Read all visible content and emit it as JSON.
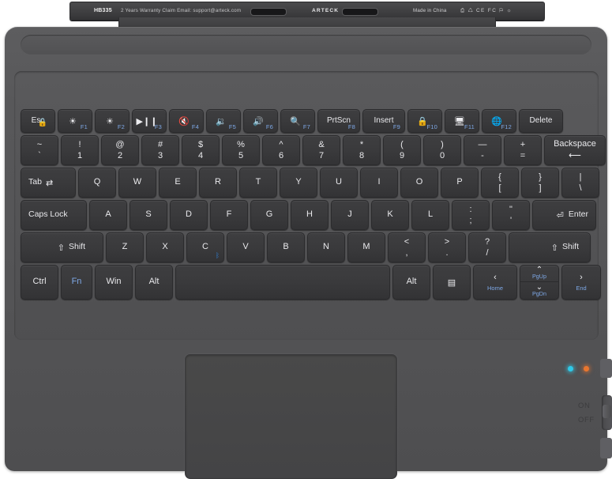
{
  "product": {
    "brand": "ARTECK",
    "model": "HB335",
    "warranty_text": "2 Years Warranty Claim Email: support@arteck.com",
    "origin": "Made in China",
    "certifications": "⎙ ♺ CE FC ⚐ ☼",
    "colors": {
      "body": "#55555 7",
      "key": "#3a3a3c",
      "accent_blue": "#7ea8e6",
      "led_blue": "#2fc9e8",
      "led_orange": "#e8762f"
    }
  },
  "power_switch": {
    "on_label": "ON",
    "off_label": "OFF"
  },
  "indicators": [
    {
      "name": "bluetooth-led",
      "color": "#2fc9e8"
    },
    {
      "name": "battery-led",
      "color": "#e8762f"
    }
  ],
  "keyboard": {
    "function_row": [
      {
        "label": "Esc",
        "fn": "",
        "glyph": "",
        "badge": "lock"
      },
      {
        "label": "",
        "fn": "F1",
        "glyph": "☀",
        "badge": ""
      },
      {
        "label": "",
        "fn": "F2",
        "glyph": "☀",
        "badge": ""
      },
      {
        "label": "",
        "fn": "F3",
        "glyph": "▶❙❙",
        "badge": ""
      },
      {
        "label": "",
        "fn": "F4",
        "glyph": "🔇",
        "badge": ""
      },
      {
        "label": "",
        "fn": "F5",
        "glyph": "🔉",
        "badge": ""
      },
      {
        "label": "",
        "fn": "F6",
        "glyph": "🔊",
        "badge": ""
      },
      {
        "label": "",
        "fn": "F7",
        "glyph": "🔍",
        "badge": ""
      },
      {
        "label": "PrtScn",
        "fn": "F8",
        "glyph": "",
        "badge": ""
      },
      {
        "label": "Insert",
        "fn": "F9",
        "glyph": "",
        "badge": ""
      },
      {
        "label": "",
        "fn": "F10",
        "glyph": "🔒",
        "badge": ""
      },
      {
        "label": "",
        "fn": "F11",
        "glyph": "🖥",
        "badge": ""
      },
      {
        "label": "",
        "fn": "F12",
        "glyph": "🌐",
        "badge": ""
      },
      {
        "label": "Delete",
        "fn": "",
        "glyph": "",
        "badge": ""
      }
    ],
    "number_row": [
      {
        "top": "~",
        "bot": "`"
      },
      {
        "top": "!",
        "bot": "1"
      },
      {
        "top": "@",
        "bot": "2"
      },
      {
        "top": "#",
        "bot": "3"
      },
      {
        "top": "$",
        "bot": "4"
      },
      {
        "top": "%",
        "bot": "5"
      },
      {
        "top": "^",
        "bot": "6"
      },
      {
        "top": "&",
        "bot": "7"
      },
      {
        "top": "*",
        "bot": "8"
      },
      {
        "top": "(",
        "bot": "9"
      },
      {
        "top": ")",
        "bot": "0"
      },
      {
        "top": "—",
        "bot": "-"
      },
      {
        "top": "+",
        "bot": "="
      }
    ],
    "backspace": {
      "label": "Backspace",
      "glyph": "⟵"
    },
    "tab_row": {
      "tab": {
        "label": "Tab",
        "glyph": "⇄"
      },
      "keys": [
        "Q",
        "W",
        "E",
        "R",
        "T",
        "Y",
        "U",
        "I",
        "O",
        "P"
      ],
      "brackets": [
        {
          "top": "{",
          "bot": "["
        },
        {
          "top": "}",
          "bot": "]"
        },
        {
          "top": "|",
          "bot": "\\"
        }
      ]
    },
    "home_row": {
      "caps": "Caps Lock",
      "keys": [
        "A",
        "S",
        "D",
        "F",
        "G",
        "H",
        "J",
        "K",
        "L"
      ],
      "punct": [
        {
          "top": ":",
          "bot": ";"
        },
        {
          "top": "\"",
          "bot": "'"
        }
      ],
      "enter": {
        "label": "Enter",
        "glyph": "⏎"
      }
    },
    "shift_row": {
      "left_shift": {
        "label": "Shift",
        "glyph": "⇧"
      },
      "keys": [
        "Z",
        "X",
        "C",
        "V",
        "B",
        "N",
        "M"
      ],
      "bt_key": "C",
      "punct": [
        {
          "top": "<",
          "bot": ","
        },
        {
          "top": ">",
          "bot": "."
        },
        {
          "top": "?",
          "bot": "/"
        }
      ],
      "right_shift": {
        "label": "Shift",
        "glyph": "⇧"
      }
    },
    "bottom_row": {
      "ctrl": "Ctrl",
      "fn": "Fn",
      "win": "Win",
      "alt_left": "Alt",
      "space": "",
      "alt_right": "Alt",
      "menu_glyph": "▤",
      "arrow_left": {
        "glyph": "‹",
        "sub": "Home"
      },
      "arrow_up": {
        "glyph": "⌃",
        "sub": "PgUp"
      },
      "arrow_down": {
        "glyph": "⌄",
        "sub": "PgDn"
      },
      "arrow_right": {
        "glyph": "›",
        "sub": "End"
      }
    }
  }
}
